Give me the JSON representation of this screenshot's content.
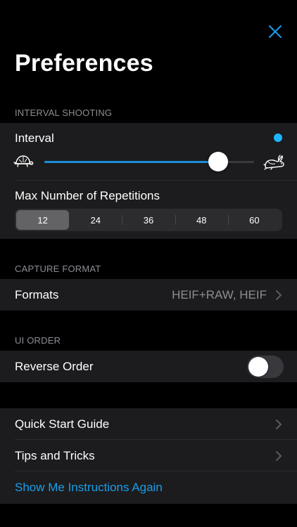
{
  "header": {
    "title": "Preferences",
    "close_icon": "close-icon"
  },
  "interval_section": {
    "header": "INTERVAL SHOOTING",
    "interval_label": "Interval",
    "slider_value_fraction": 0.83,
    "slow_icon": "turtle-icon",
    "fast_icon": "rabbit-icon",
    "repetitions_label": "Max Number of Repetitions",
    "repetitions_options": [
      "12",
      "24",
      "36",
      "48",
      "60"
    ],
    "repetitions_selected": "12"
  },
  "capture_section": {
    "header": "CAPTURE FORMAT",
    "formats_label": "Formats",
    "formats_value": "HEIF+RAW, HEIF"
  },
  "ui_order_section": {
    "header": "UI ORDER",
    "reverse_label": "Reverse Order",
    "reverse_enabled": false
  },
  "help_section": {
    "quick_start_label": "Quick Start Guide",
    "tips_label": "Tips and Tricks",
    "instructions_label": "Show Me Instructions Again"
  },
  "colors": {
    "accent": "#1a8fd8",
    "dot": "#1fb4ff",
    "background": "#000000",
    "group_background": "#1c1c1e",
    "secondary_text": "#8d8d93"
  }
}
